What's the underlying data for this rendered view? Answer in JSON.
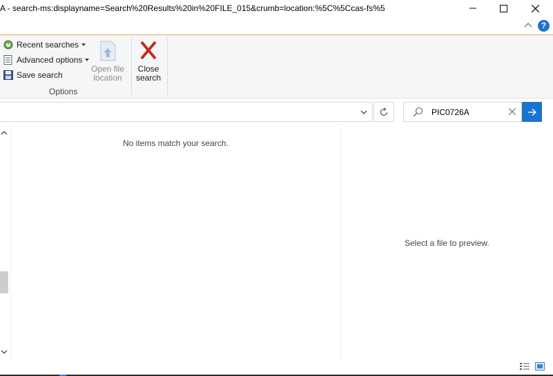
{
  "window": {
    "title": "A - search-ms:displayname=Search%20Results%20in%20FILE_015&crumb=location:%5C%5Ccas-fs%5"
  },
  "ribbon": {
    "recent_searches": "Recent searches",
    "advanced_options": "Advanced options",
    "save_search": "Save search",
    "open_file_location_line1": "Open file",
    "open_file_location_line2": "location",
    "close_search_line1": "Close",
    "close_search_line2": "search",
    "group_options": "Options"
  },
  "search": {
    "query": "PIC0726A"
  },
  "content": {
    "empty_message": "No items match your search.",
    "preview_message": "Select a file to preview."
  },
  "colors": {
    "accent": "#1a73d1",
    "close_x": "#c42b1c",
    "ribbon_line": "#f0a35a"
  }
}
